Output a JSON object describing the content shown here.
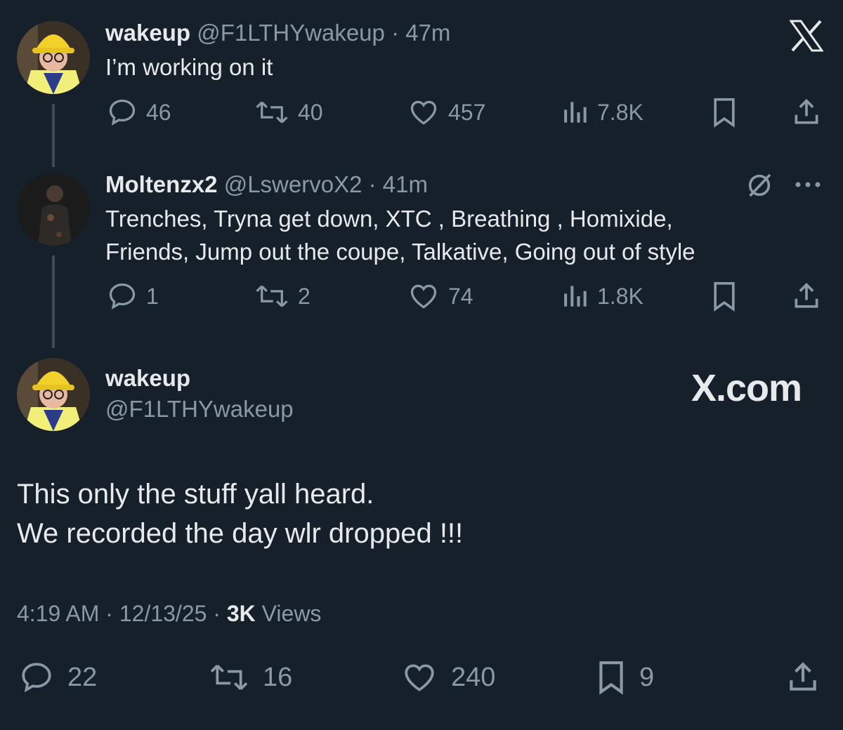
{
  "tweet1": {
    "name": "wakeup",
    "handle": "@F1LTHYwakeup",
    "time": "· 47m",
    "text": "I’m working on it",
    "replies": "46",
    "retweets": "40",
    "likes": "457",
    "views": "7.8K"
  },
  "tweet2": {
    "name": "Moltenzx2",
    "handle": "@LswervoX2",
    "time": "· 41m",
    "text_line1": "Trenches, Tryna get down, XTC , Breathing , Homixide,",
    "text_line2": "Friends, Jump out the coupe, Talkative, Going out of style",
    "replies": "1",
    "retweets": "2",
    "likes": "74",
    "views": "1.8K"
  },
  "main": {
    "name": "wakeup",
    "handle": "@F1LTHYwakeup",
    "brand": "X.com",
    "text_line1": "This only the stuff yall heard.",
    "text_line2": "We recorded the day wlr dropped !!!",
    "time": "4:19 AM",
    "date": "· 12/13/25 ·",
    "views_count": "3K",
    "views_label": "Views",
    "replies": "22",
    "retweets": "16",
    "likes": "240",
    "bookmarks": "9"
  },
  "colors": {
    "background": "#15202b",
    "text": "#e7e9ea",
    "muted": "#8b98a5",
    "thread_line": "#3d4b59"
  }
}
